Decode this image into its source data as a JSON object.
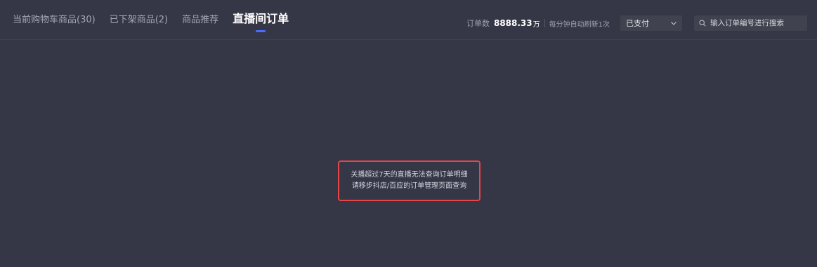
{
  "tabs": [
    {
      "label": "当前购物车商品(30)",
      "active": false
    },
    {
      "label": "已下架商品(2)",
      "active": false
    },
    {
      "label": "商品推荐",
      "active": false
    },
    {
      "label": "直播间订单",
      "active": true
    }
  ],
  "toolbar": {
    "order_count_label": "订单数",
    "order_count_value": "8888.33",
    "order_count_unit": "万",
    "refresh_note": "每分钟自动刷新1次",
    "status_selected": "已支付",
    "search_placeholder": "输入订单编号进行搜索"
  },
  "notice": {
    "line1": "关播超过7天的直播无法查询订单明细",
    "line2": "请移步抖店/百应的订单管理页面查询"
  },
  "colors": {
    "background": "#353646",
    "active_underline": "#4a6cff",
    "notice_border": "#e6454a"
  },
  "icons": {
    "select_chevron": "chevron-down-icon",
    "search": "search-icon"
  }
}
